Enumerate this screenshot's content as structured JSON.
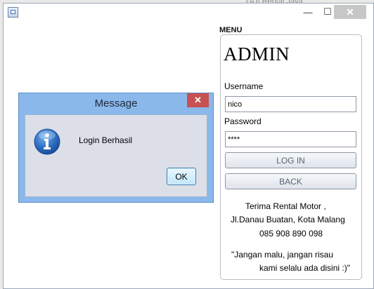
{
  "background": {
    "text": "GUI Rental Java"
  },
  "window": {
    "title": "",
    "minimize_glyph": "—",
    "maximize_glyph": "☐",
    "close_glyph": "✕"
  },
  "menu": {
    "section_label": "MENU",
    "heading": "ADMIN",
    "username_label": "Username",
    "username_value": "nico",
    "password_label": "Password",
    "password_value": "****",
    "login_button": "LOG IN",
    "back_button": "BACK",
    "info_lines": [
      "Terima Rental Motor ,",
      "Jl.Danau Buatan, Kota Malang",
      "085 908 890 098"
    ],
    "quote_lines": [
      "\"Jangan malu, jangan risau",
      "kami selalu ada disini :)\""
    ]
  },
  "dialog": {
    "title": "Message",
    "close_glyph": "✕",
    "message": "Login Berhasil",
    "ok_button": "OK",
    "icon": "info-icon"
  },
  "colors": {
    "dialog_frame": "#8ab8ea",
    "dialog_close": "#c75050",
    "info_icon_blue": "#2f6fc4"
  }
}
